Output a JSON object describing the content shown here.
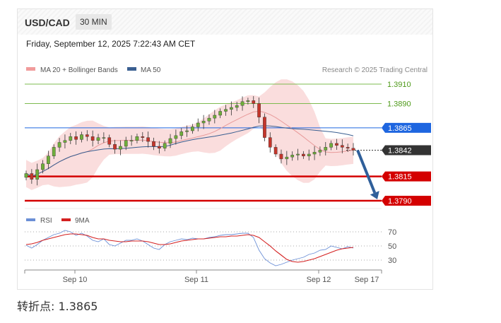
{
  "header": {
    "pair": "USD/CAD",
    "timeframe": "30 MIN"
  },
  "timestamp": "Friday, September 12, 2025 7:22:43 AM CET",
  "legend": {
    "ma_bb": "MA 20 + Bollinger Bands",
    "ma50": "MA 50",
    "rsi": "RSI",
    "rsi_ma": "9MA",
    "credit": "Research © 2025 Trading Central"
  },
  "footer": {
    "pivot": "转折点: 1.3865"
  },
  "colors": {
    "resistance": "#7dbb4f",
    "resistance_text": "#4f9a1a",
    "pivot": "#1e66e0",
    "last": "#333333",
    "support": "#d40000",
    "up_candle": "#6fae3a",
    "down_candle": "#c4352b",
    "bollinger": "#f6c1c1",
    "ma20": "#e89a9a",
    "ma50": "#3a5f91",
    "rsi": "#6b8fd6",
    "rsi_ma": "#d42020",
    "arrow": "#2f5f9a"
  },
  "chart_data": [
    {
      "type": "candlestick",
      "x_ticks": [
        "Sep 10",
        "Sep 11",
        "Sep 12",
        "Sep 17"
      ],
      "levels": [
        {
          "label": "1.3910",
          "value": 1.391,
          "kind": "resistance"
        },
        {
          "label": "1.3890",
          "value": 1.389,
          "kind": "resistance"
        },
        {
          "label": "1.3865",
          "value": 1.3865,
          "kind": "pivot"
        },
        {
          "label": "1.3842",
          "value": 1.3842,
          "kind": "last"
        },
        {
          "label": "1.3815",
          "value": 1.3815,
          "kind": "support"
        },
        {
          "label": "1.3790",
          "value": 1.379,
          "kind": "support"
        }
      ],
      "series": [
        {
          "name": "MA 20 + Bollinger Bands"
        },
        {
          "name": "MA 50"
        }
      ],
      "forecast_arrow": {
        "from": 1.3842,
        "to": 1.379
      },
      "close": [
        1.3818,
        1.3812,
        1.3822,
        1.3828,
        1.3836,
        1.3845,
        1.385,
        1.3852,
        1.3856,
        1.3853,
        1.3858,
        1.3856,
        1.3852,
        1.3855,
        1.3855,
        1.3848,
        1.3843,
        1.3846,
        1.3852,
        1.3852,
        1.3856,
        1.3855,
        1.3851,
        1.3846,
        1.3844,
        1.3849,
        1.3854,
        1.3857,
        1.3861,
        1.3862,
        1.3866,
        1.387,
        1.3872,
        1.3875,
        1.3878,
        1.3882,
        1.3884,
        1.3886,
        1.3888,
        1.3892,
        1.3893,
        1.389,
        1.3876,
        1.3855,
        1.3845,
        1.3838,
        1.3833,
        1.3835,
        1.3837,
        1.3838,
        1.3836,
        1.3838,
        1.384,
        1.3842,
        1.3845,
        1.3849,
        1.3847,
        1.3845,
        1.3844,
        1.3842
      ]
    },
    {
      "type": "line",
      "series": [
        {
          "name": "RSI"
        },
        {
          "name": "9MA"
        }
      ],
      "y_ticks": [
        70,
        50,
        30
      ],
      "ylim": [
        20,
        80
      ],
      "rsi": [
        51,
        47,
        52,
        58,
        62,
        66,
        68,
        72,
        70,
        65,
        68,
        64,
        58,
        56,
        60,
        52,
        50,
        54,
        58,
        58,
        60,
        57,
        52,
        47,
        45,
        52,
        56,
        58,
        60,
        59,
        61,
        60,
        60,
        62,
        63,
        65,
        66,
        66,
        67,
        68,
        68,
        62,
        44,
        32,
        26,
        22,
        24,
        27,
        30,
        32,
        34,
        38,
        40,
        44,
        45,
        50,
        48,
        46,
        49,
        47
      ],
      "rsi_ma": [
        52,
        53,
        55,
        58,
        60,
        62,
        64,
        66,
        67,
        67,
        66,
        65,
        62,
        60,
        60,
        58,
        57,
        56,
        56,
        57,
        57,
        57,
        56,
        54,
        52,
        52,
        53,
        55,
        57,
        58,
        59,
        60,
        60,
        61,
        62,
        63,
        63,
        64,
        64,
        65,
        66,
        65,
        62,
        56,
        50,
        43,
        37,
        31,
        28,
        27,
        28,
        30,
        32,
        35,
        38,
        41,
        44,
        46,
        47,
        48
      ]
    }
  ]
}
